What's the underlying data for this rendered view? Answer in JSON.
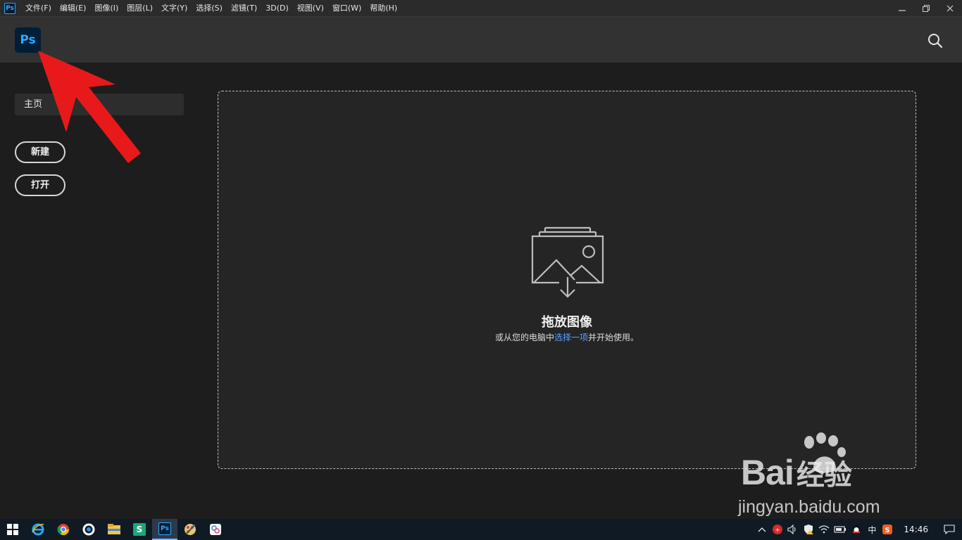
{
  "menubar": {
    "app_icon": "Ps",
    "items": [
      "文件(F)",
      "编辑(E)",
      "图像(I)",
      "图层(L)",
      "文字(Y)",
      "选择(S)",
      "滤镜(T)",
      "3D(D)",
      "视图(V)",
      "窗口(W)",
      "帮助(H)"
    ],
    "window_buttons": [
      "minimize-icon",
      "restore-icon",
      "close-icon"
    ]
  },
  "header": {
    "logo": "Ps",
    "search_icon": "search-icon"
  },
  "sidebar": {
    "home_label": "主页",
    "new_label": "新建",
    "open_label": "打开"
  },
  "dropzone": {
    "title": "拖放图像",
    "sub_before": "或从您的电脑中",
    "sub_link": "选择一项",
    "sub_after": "并开始使用。"
  },
  "watermark": {
    "brand": "Bai",
    "brand2": "经验",
    "url": "jingyan.baidu.com"
  },
  "taskbar": {
    "apps": [
      "ie-icon",
      "chrome-icon",
      "browser-icon",
      "file-explorer-icon",
      "wps-icon",
      "photoshop-icon",
      "paint-icon",
      "app-icon"
    ],
    "ps_label": "Ps",
    "wps_label": "S",
    "ime": "中",
    "time": "14:46"
  },
  "colors": {
    "accent_link": "#5aa2ff",
    "ps_blue": "#31a8ff",
    "arrow_red": "#e8191b"
  }
}
